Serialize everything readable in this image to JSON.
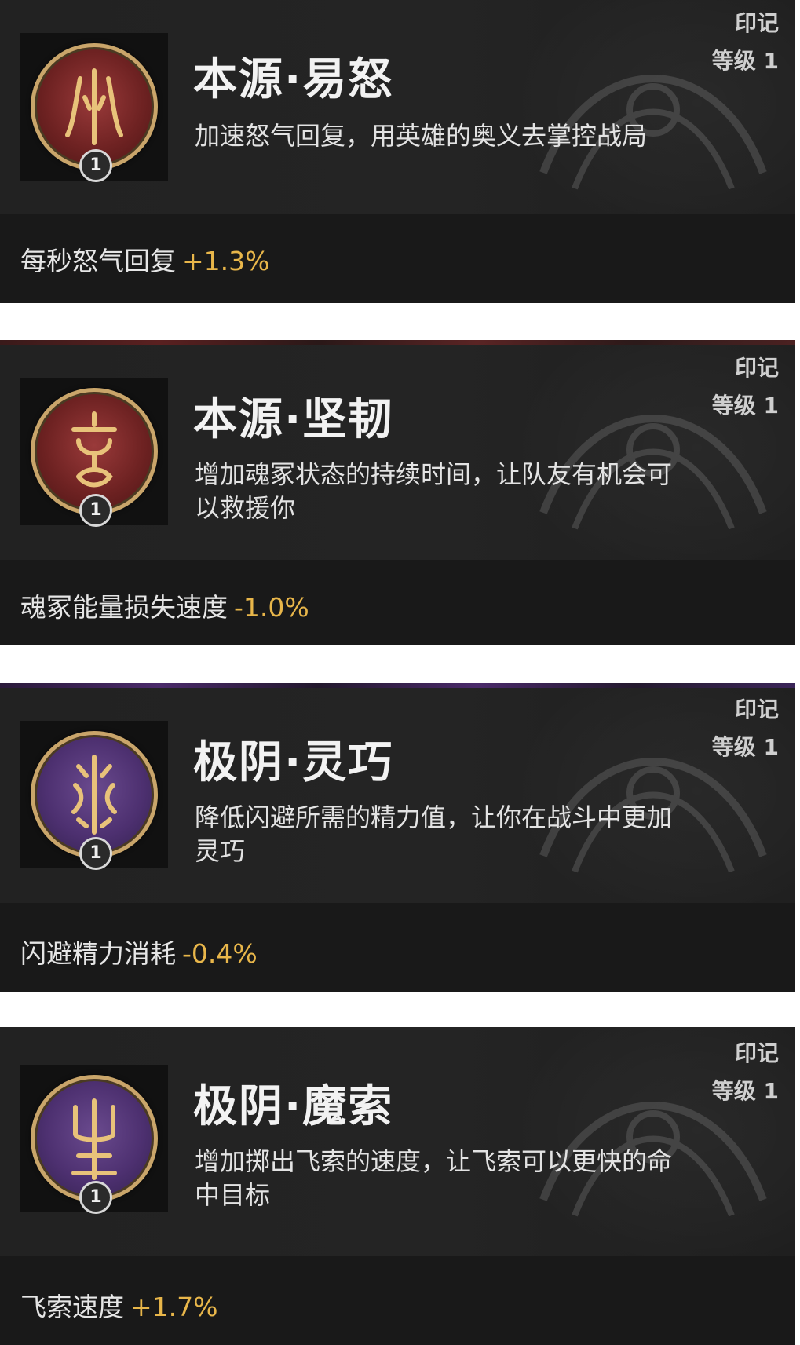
{
  "cards": [
    {
      "title": "本源·易怒",
      "description": "加速怒气回复，用英雄的奥义去掌控战局",
      "tag": "印记",
      "level": "等级 1",
      "badge": "1",
      "stat_label": "每秒怒气回复",
      "stat_value": "+1.3%",
      "medal_color": "#7a2626"
    },
    {
      "title": "本源·坚韧",
      "description": "增加魂冢状态的持续时间，让队友有机会可以救援你",
      "tag": "印记",
      "level": "等级 1",
      "badge": "1",
      "stat_label": "魂冢能量损失速度",
      "stat_value": "-1.0%",
      "medal_color": "#7a2626"
    },
    {
      "title": "极阴·灵巧",
      "description": "降低闪避所需的精力值，让你在战斗中更加灵巧",
      "tag": "印记",
      "level": "等级 1",
      "badge": "1",
      "stat_label": "闪避精力消耗",
      "stat_value": "-0.4%",
      "medal_color": "#4d3070"
    },
    {
      "title": "极阴·魔索",
      "description": "增加掷出飞索的速度，让飞索可以更快的命中目标",
      "tag": "印记",
      "level": "等级 1",
      "badge": "1",
      "stat_label": "飞索速度",
      "stat_value": "+1.7%",
      "medal_color": "#4d3070"
    }
  ],
  "colors": {
    "card_bg": "#1c1c1c",
    "title_text": "#f2f2f2",
    "stat_value": "#e8b64a",
    "medal_rim": "#c9a56a"
  },
  "icons": [
    "rage-rune-icon",
    "toughness-rune-icon",
    "agility-rune-icon",
    "grapple-rune-icon"
  ]
}
